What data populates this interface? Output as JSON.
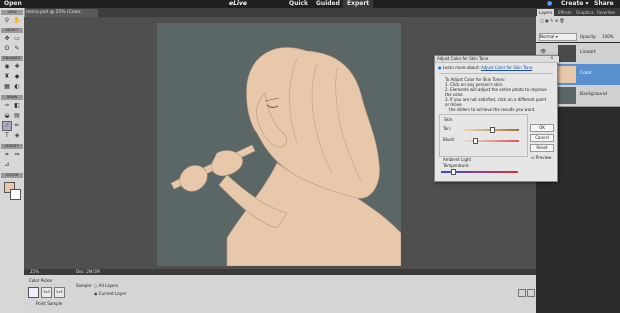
{
  "topbar": {
    "open": "Open",
    "app": "eLive",
    "quick": "Quick",
    "guided": "Guided",
    "expert": "Expert",
    "create": "Create ▾",
    "share": "Share"
  },
  "document": {
    "tab_label": "mono.psd @ 25% (Color, RGB/8) *"
  },
  "toolbox": {
    "view": "VIEW",
    "select": "SELECT",
    "enhance": "ENHANCE",
    "draw": "DRAW",
    "modify": "MODIFY",
    "color": "COLOR"
  },
  "status": {
    "zoom": "25%",
    "doc_info": "Doc: 2M/1M"
  },
  "options": {
    "title": "Color Picker",
    "sample_label": "Sample:",
    "all_layers": "All Layers",
    "current_layer": "Current Layer",
    "sample_size": "Point Sample"
  },
  "panel": {
    "tabs": [
      "Layers",
      "Effects",
      "Graphics",
      "Favorites"
    ],
    "blend_mode": "Normal",
    "opacity_label": "Opacity:",
    "opacity_value": "100%",
    "layers": [
      {
        "name": "Lineart"
      },
      {
        "name": "Color"
      },
      {
        "name": "Background"
      }
    ]
  },
  "dialog": {
    "title": "Adjust Color for Skin Tone",
    "learn_prefix": "Learn more about:",
    "learn_link": "Adjust Color for Skin Tone",
    "instr_title": "To Adjust Color for Skin Tones:",
    "instr_1": "1. Click on any person's skin.",
    "instr_2": "2. Elements will adjust the entire photo to improve the color.",
    "instr_3": "3. If you are not satisfied, click on a different point or move",
    "instr_4": "the sliders to achieve the results you want.",
    "skin_label": "Skin",
    "tan_label": "Tan:",
    "blush_label": "Blush:",
    "ambient_label": "Ambient Light",
    "temp_label": "Temperature:",
    "ok": "OK",
    "cancel": "Cancel",
    "reset": "Reset",
    "preview": "Preview",
    "tan_value": 0.5,
    "blush_value": 0.2,
    "temp_value": 0.15
  },
  "colors": {
    "skin": "#e8c8aa",
    "canvas_bg": "#5a6766",
    "accent": "#5a8fd0"
  }
}
